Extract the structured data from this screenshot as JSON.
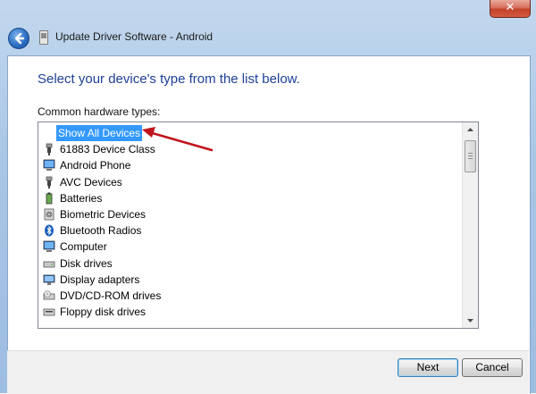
{
  "window": {
    "title": "Update Driver Software - Android",
    "close_glyph": "✕"
  },
  "content": {
    "instruction": "Select your device's type from the list below.",
    "list_label": "Common hardware types:"
  },
  "list": {
    "items": [
      {
        "label": "Show All Devices",
        "icon": "none",
        "selected": true
      },
      {
        "label": "61883 Device Class",
        "icon": "usb-plug-icon"
      },
      {
        "label": "Android Phone",
        "icon": "computer-monitor-icon"
      },
      {
        "label": "AVC Devices",
        "icon": "usb-plug-icon"
      },
      {
        "label": "Batteries",
        "icon": "battery-icon"
      },
      {
        "label": "Biometric Devices",
        "icon": "fingerprint-icon"
      },
      {
        "label": "Bluetooth Radios",
        "icon": "bluetooth-icon"
      },
      {
        "label": "Computer",
        "icon": "computer-monitor-icon"
      },
      {
        "label": "Disk drives",
        "icon": "disk-drive-icon"
      },
      {
        "label": "Display adapters",
        "icon": "display-adapter-icon"
      },
      {
        "label": "DVD/CD-ROM drives",
        "icon": "dvd-drive-icon"
      },
      {
        "label": "Floppy disk drives",
        "icon": "floppy-drive-icon"
      }
    ]
  },
  "buttons": {
    "next_label": "Next",
    "cancel_label": "Cancel"
  },
  "colors": {
    "instruction_text": "#1e3f96",
    "selection": "#3399ff",
    "annotation_arrow": "#c0141c"
  }
}
